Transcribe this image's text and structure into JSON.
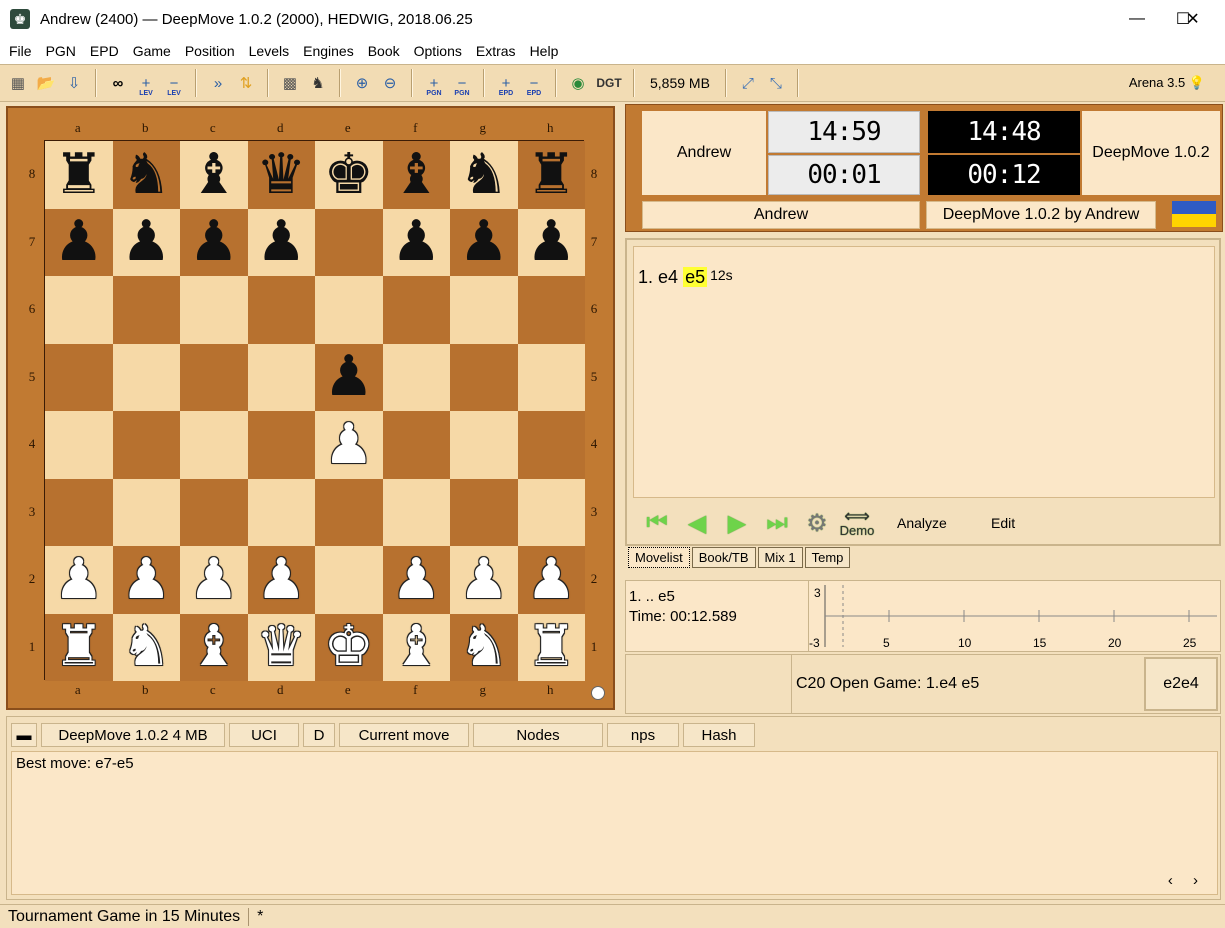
{
  "window": {
    "title": "Andrew (2400)  —  DeepMove 1.0.2 (2000),   HEDWIG,   2018.06.25",
    "minimize": "—",
    "maximize": "☐",
    "close": "✕"
  },
  "menu": [
    "File",
    "PGN",
    "EPD",
    "Game",
    "Position",
    "Levels",
    "Engines",
    "Book",
    "Options",
    "Extras",
    "Help"
  ],
  "toolbar": {
    "icons": [
      "new-board-icon",
      "open-folder-icon",
      "save-icon",
      "infinite-analysis-icon",
      "level-plus-icon",
      "level-minus-icon",
      "fast-forward-icon",
      "flip-board-icon",
      "set-position-icon",
      "engine-match-icon",
      "zoom-in-icon",
      "zoom-out-icon",
      "pgn-plus-icon",
      "pgn-minus-icon",
      "epd-plus-icon",
      "epd-minus-icon",
      "globe-icon",
      "dgt-icon"
    ],
    "sub_labels": {
      "lev": "LEV",
      "pgn": "PGN",
      "epd": "EPD"
    },
    "dgt": "DGT",
    "memory": "5,859 MB",
    "version": "Arena 3.5"
  },
  "board": {
    "files": [
      "a",
      "b",
      "c",
      "d",
      "e",
      "f",
      "g",
      "h"
    ],
    "ranks": [
      "8",
      "7",
      "6",
      "5",
      "4",
      "3",
      "2",
      "1"
    ],
    "position": [
      [
        "br",
        "bn",
        "bb",
        "bq",
        "bk",
        "bb",
        "bn",
        "br"
      ],
      [
        "bp",
        "bp",
        "bp",
        "bp",
        "",
        "bp",
        "bp",
        "bp"
      ],
      [
        "",
        "",
        "",
        "",
        "",
        "",
        "",
        ""
      ],
      [
        "",
        "",
        "",
        "",
        "bp",
        "",
        "",
        ""
      ],
      [
        "",
        "",
        "",
        "",
        "wp",
        "",
        "",
        ""
      ],
      [
        "",
        "",
        "",
        "",
        "",
        "",
        "",
        ""
      ],
      [
        "wp",
        "wp",
        "wp",
        "wp",
        "",
        "wp",
        "wp",
        "wp"
      ],
      [
        "wr",
        "wn",
        "wb",
        "wq",
        "wk",
        "wb",
        "wn",
        "wr"
      ]
    ]
  },
  "clock": {
    "white_name": "Andrew",
    "white_time": "14:59",
    "white_move_time": "00:01",
    "black_name": "DeepMove 1.0.2",
    "black_time": "14:48",
    "black_move_time": "00:12",
    "white_footer": "Andrew",
    "black_footer": "DeepMove 1.0.2 by Andrew"
  },
  "moves": {
    "num": "1.",
    "white": "e4",
    "black": "e5",
    "time": "12s"
  },
  "nav": {
    "demo": "Demo",
    "analyze": "Analyze",
    "edit": "Edit"
  },
  "tabs": [
    "Movelist",
    "Book/TB",
    "Mix 1",
    "Temp"
  ],
  "eval": {
    "line1": "1. .. e5",
    "line2": "Time: 00:12.589",
    "y_top": "3",
    "y_bottom": "-3",
    "x_ticks": [
      "5",
      "10",
      "15",
      "20",
      "25"
    ]
  },
  "opening": {
    "name": "C20  Open Game: 1.e4 e5",
    "move": "e2e4"
  },
  "engine": {
    "name": "DeepMove 1.0.2  4 MB",
    "protocol": "UCI",
    "d": "D",
    "current": "Current move",
    "nodes": "Nodes",
    "nps": "nps",
    "hash": "Hash",
    "output": "Best move: e7-e5",
    "scroll": "‹ ›"
  },
  "status": {
    "mode": "Tournament Game in 15 Minutes",
    "flag": "*"
  }
}
